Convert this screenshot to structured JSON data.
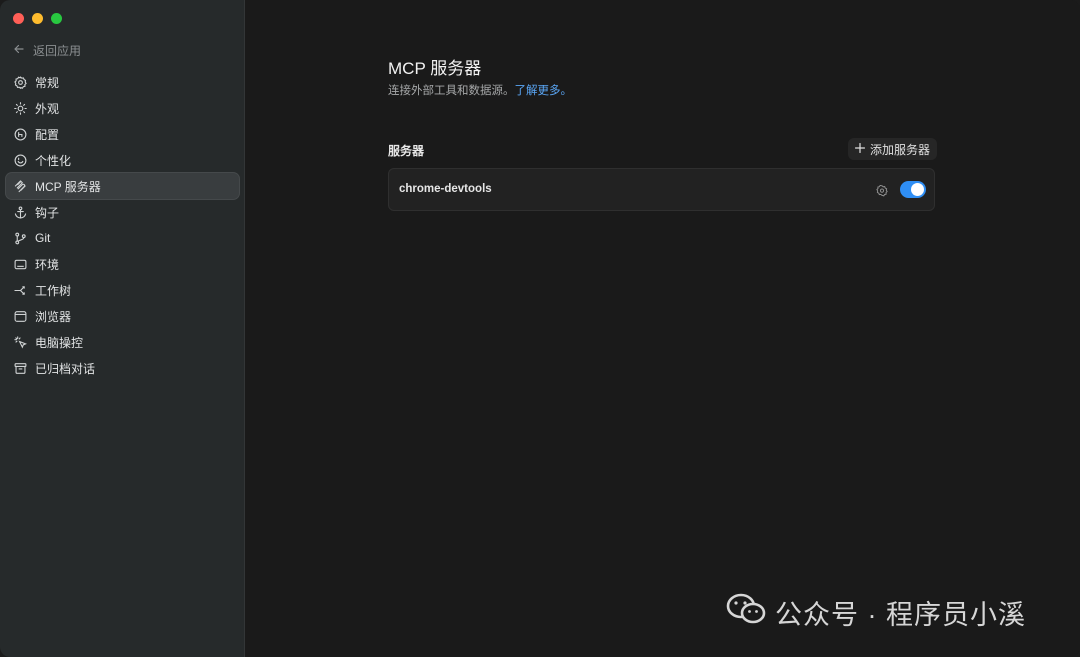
{
  "window": {
    "traffic_lights": [
      "close",
      "minimize",
      "zoom"
    ]
  },
  "sidebar": {
    "back_label": "返回应用",
    "items": [
      {
        "label": "常规",
        "icon": "gear-icon"
      },
      {
        "label": "外观",
        "icon": "sun-icon"
      },
      {
        "label": "配置",
        "icon": "config-icon"
      },
      {
        "label": "个性化",
        "icon": "personalize-icon"
      },
      {
        "label": "MCP 服务器",
        "icon": "mcp-icon",
        "active": true
      },
      {
        "label": "钩子",
        "icon": "anchor-icon"
      },
      {
        "label": "Git",
        "icon": "git-branch-icon"
      },
      {
        "label": "环境",
        "icon": "environment-icon"
      },
      {
        "label": "工作树",
        "icon": "worktree-icon"
      },
      {
        "label": "浏览器",
        "icon": "browser-icon"
      },
      {
        "label": "电脑操控",
        "icon": "computer-control-icon"
      },
      {
        "label": "已归档对话",
        "icon": "archive-icon"
      }
    ]
  },
  "main": {
    "title": "MCP 服务器",
    "subtitle": "连接外部工具和数据源。",
    "subtitle_link": "了解更多。",
    "section_label": "服务器",
    "add_button": "添加服务器",
    "servers": [
      {
        "name": "chrome-devtools",
        "enabled": true
      }
    ]
  },
  "watermark": {
    "text": "公众号 · 程序员小溪",
    "icon": "wechat-icon"
  },
  "colors": {
    "accent": "#2f8ef4",
    "link": "#5aa6f5",
    "sidebar_bg": "#262a2b",
    "main_bg": "#1a1a1a"
  }
}
